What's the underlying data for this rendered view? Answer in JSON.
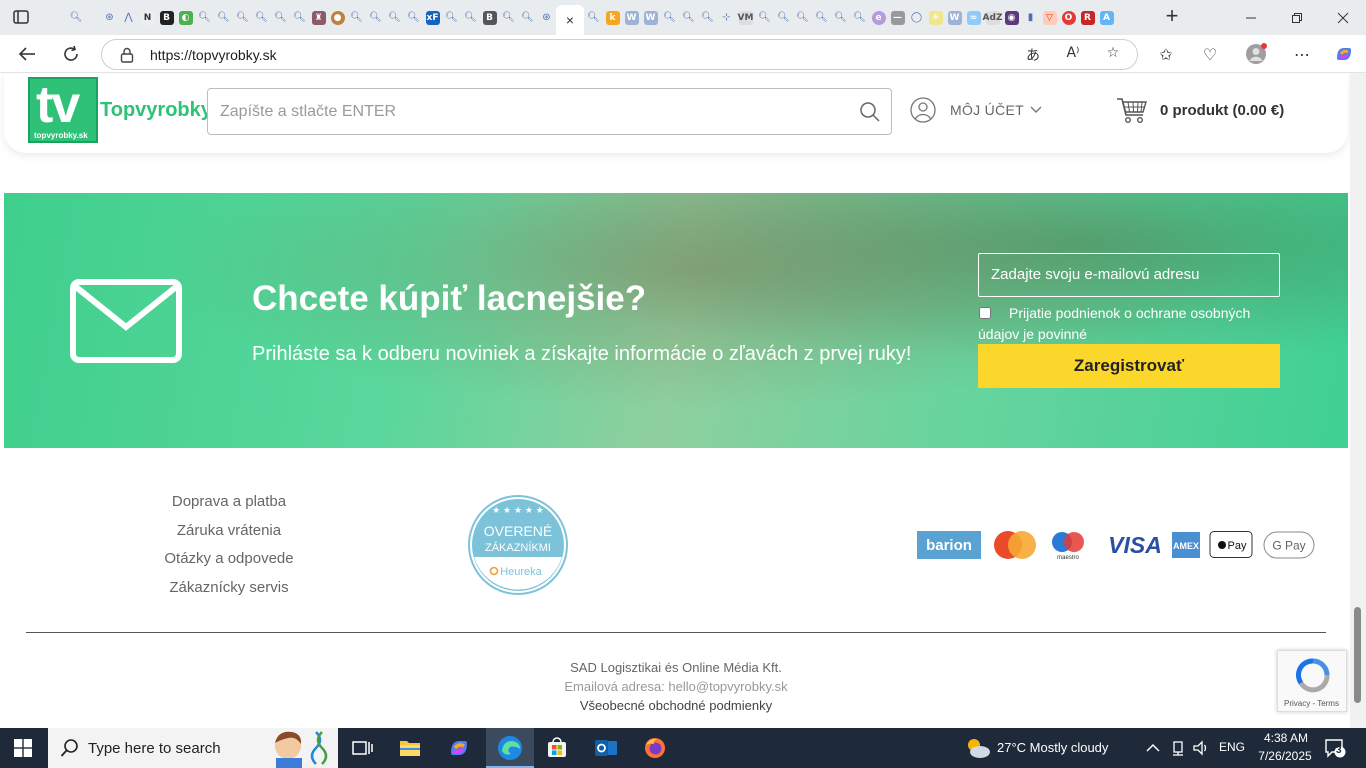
{
  "browser": {
    "url": "https://topvyrobky.sk",
    "tab_close_glyph": "×",
    "new_tab_glyph": "+"
  },
  "header": {
    "logo_text": "tv",
    "logo_subtext": "topvyrobky.sk",
    "brand_name": "Topvyrobky",
    "search_placeholder": "Zapíšte a stlačte ENTER",
    "account_label": "MÔJ ÚČET",
    "cart_label": "0 produkt (0.00 €)"
  },
  "newsletter": {
    "title": "Chcete kúpiť lacnejšie?",
    "subtitle": "Prihláste sa k odberu noviniek a získajte informácie o zľavách z prvej ruky!",
    "email_placeholder": "Zadajte svoju e-mailovú adresu",
    "consent_label": "Prijatie podnienok o ochrane osobných údajov je povinné",
    "button_label": "Zaregistrovať"
  },
  "footer": {
    "links": [
      "Doprava a platba",
      "Záruka vrátenia",
      "Otázky a odpovede",
      "Zákaznícky servis"
    ],
    "badge_top": "OVERENÉ",
    "badge_middle": "ZÁKAZNÍKMI",
    "badge_bottom": "Heureka",
    "payments": [
      "barion",
      "mastercard",
      "maestro",
      "VISA",
      "AMEX",
      "Pay",
      "G Pay"
    ],
    "company": "SAD Logisztikai és Online Média Kft.",
    "email_line": "Emailová adresa: hello@topvyrobky.sk",
    "terms": "Všeobecné obchodné podmienky"
  },
  "recaptcha": {
    "text": "Privacy - Terms"
  },
  "taskbar": {
    "search_placeholder": "Type here to search",
    "weather": "27°C  Mostly cloudy",
    "language": "ENG",
    "time": "4:38 AM",
    "date": "7/26/2025",
    "notification_count": "3"
  },
  "colors": {
    "brand_green": "#2fc178",
    "button_yellow": "#fbd72b"
  }
}
